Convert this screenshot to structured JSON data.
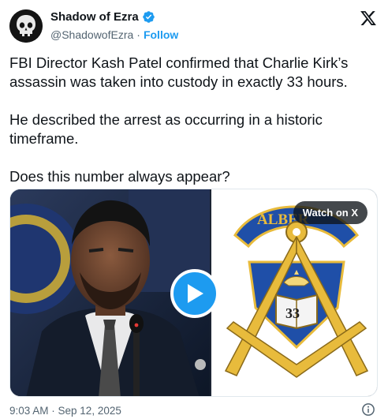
{
  "author": {
    "name": "Shadow of Ezra",
    "handle": "@ShadowofEzra",
    "separator": "·",
    "follow_label": "Follow",
    "verified": true
  },
  "tweet": {
    "paragraphs": [
      "FBI Director Kash Patel confirmed that Charlie Kirk’s assassin was taken into custody in exactly 33 hours.",
      "He described the arrest as occurring in a historic timeframe.",
      "Does this number always appear?"
    ]
  },
  "media": {
    "watch_label": "Watch on X",
    "emblem_banner_text": "ALBER",
    "emblem_book_text": "33"
  },
  "footer": {
    "timestamp": "9:03 AM · Sep 12, 2025"
  },
  "colors": {
    "accent": "#1d9bf0",
    "text": "#0f1419",
    "muted": "#536471",
    "emblem_blue": "#1f4fa8",
    "emblem_gold": "#e8bb3c"
  },
  "icons": {
    "platform": "x-logo-icon",
    "verified": "verified-badge-icon",
    "play": "play-icon",
    "info": "info-icon"
  }
}
